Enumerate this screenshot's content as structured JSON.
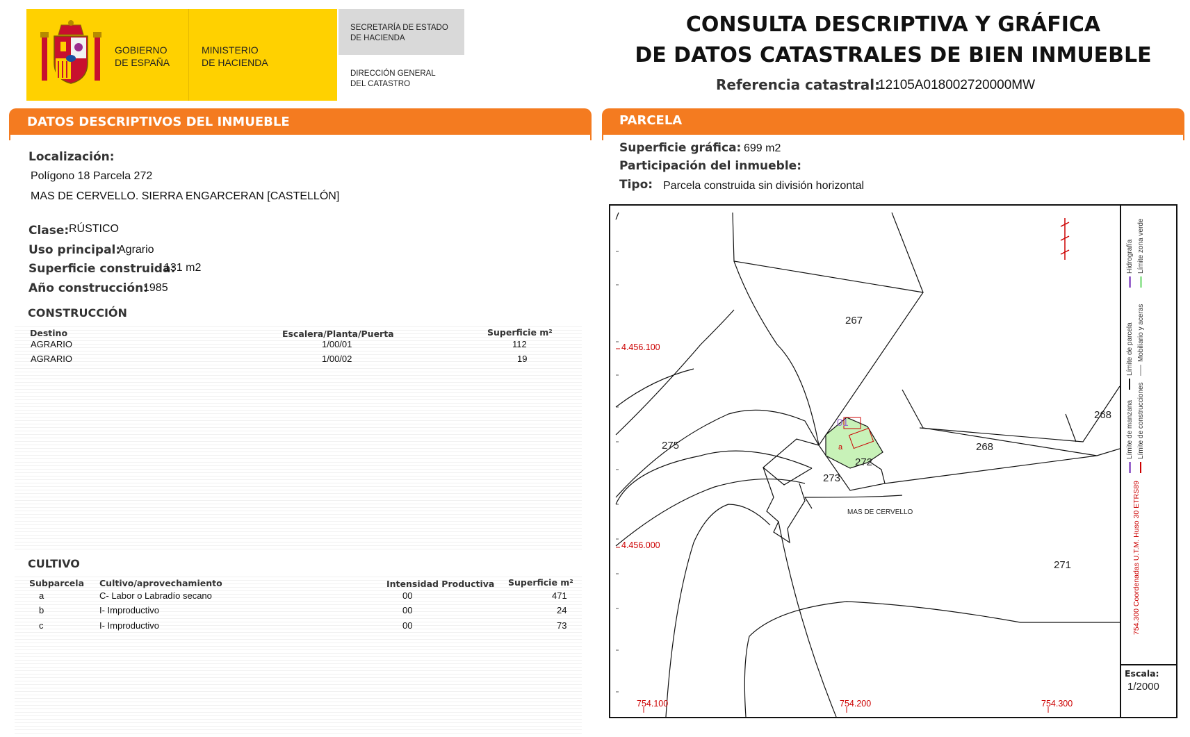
{
  "header": {
    "gobierno": [
      "GOBIERNO",
      "DE ESPAÑA"
    ],
    "ministerio": [
      "MINISTERIO",
      "DE HACIENDA"
    ],
    "secretaria": [
      "SECRETARÍA DE ESTADO",
      "DE HACIENDA"
    ],
    "direccion": [
      "DIRECCIÓN GENERAL",
      "DEL CATASTRO"
    ],
    "title_line1": "CONSULTA DESCRIPTIVA Y GRÁFICA",
    "title_line2": "DE DATOS CATASTRALES DE BIEN INMUEBLE",
    "ref_label": "Referencia catastral:",
    "ref_value": "12105A018002720000MW"
  },
  "left": {
    "section_title": "DATOS DESCRIPTIVOS DEL INMUEBLE",
    "localizacion_label": "Localización:",
    "localizacion_line1": "Polígono 18 Parcela 272",
    "localizacion_line2": "MAS DE CERVELLO. SIERRA ENGARCERAN [CASTELLÓN]",
    "clase_label": "Clase:",
    "clase_value": "RÚSTICO",
    "uso_label": "Uso principal:",
    "uso_value": "Agrario",
    "sup_label": "Superficie construida:",
    "sup_value": "131 m2",
    "anio_label": "Año construcción:",
    "anio_value": "1985",
    "construccion": {
      "title": "CONSTRUCCIÓN",
      "headers": [
        "Destino",
        "Escalera/Planta/Puerta",
        "Superficie m²"
      ],
      "rows": [
        [
          "AGRARIO",
          "1/00/01",
          "112"
        ],
        [
          "AGRARIO",
          "1/00/02",
          "19"
        ]
      ]
    },
    "cultivo": {
      "title": "CULTIVO",
      "headers": [
        "Subparcela",
        "Cultivo/aprovechamiento",
        "Intensidad Productiva",
        "Superficie m²"
      ],
      "rows": [
        [
          "a",
          "C- Labor o Labradío secano",
          "00",
          "471"
        ],
        [
          "b",
          "I- Improductivo",
          "00",
          "24"
        ],
        [
          "c",
          "I- Improductivo",
          "00",
          "73"
        ]
      ]
    }
  },
  "right": {
    "section_title": "PARCELA",
    "sup_grafica_label": "Superficie gráfica:",
    "sup_grafica_value": "699 m2",
    "participacion_label": "Participación del inmueble:",
    "tipo_label": "Tipo:",
    "tipo_value": "Parcela construida sin división horizontal"
  },
  "map": {
    "parcel_numbers": [
      "267",
      "268",
      "268",
      "275",
      "272",
      "273",
      "271"
    ],
    "place_name": "MAS DE CERVELLO",
    "coord_y": [
      "4.456.100",
      "4.456.000"
    ],
    "coord_x": [
      "754.100",
      "754.200",
      "754.300"
    ],
    "legend": {
      "hidrografia": "Hidrografía",
      "zona_verde": "Límite zona verde",
      "parcela": "Límite de parcela",
      "mobiliario": "Mobiliario y aceras",
      "manzana": "Límite de manzana",
      "construcciones": "Límite de construcciones",
      "coords": "Coordenadas U.T.M. Huso 30 ETRS89",
      "coords_prefix": "754.300"
    },
    "escala_label": "Escala:",
    "escala_value": "1/2000",
    "colors": {
      "parcel_fill": "#C8F2B8",
      "accent": "#F47B20",
      "red": "#CC0000",
      "purple": "#9966CC"
    }
  }
}
